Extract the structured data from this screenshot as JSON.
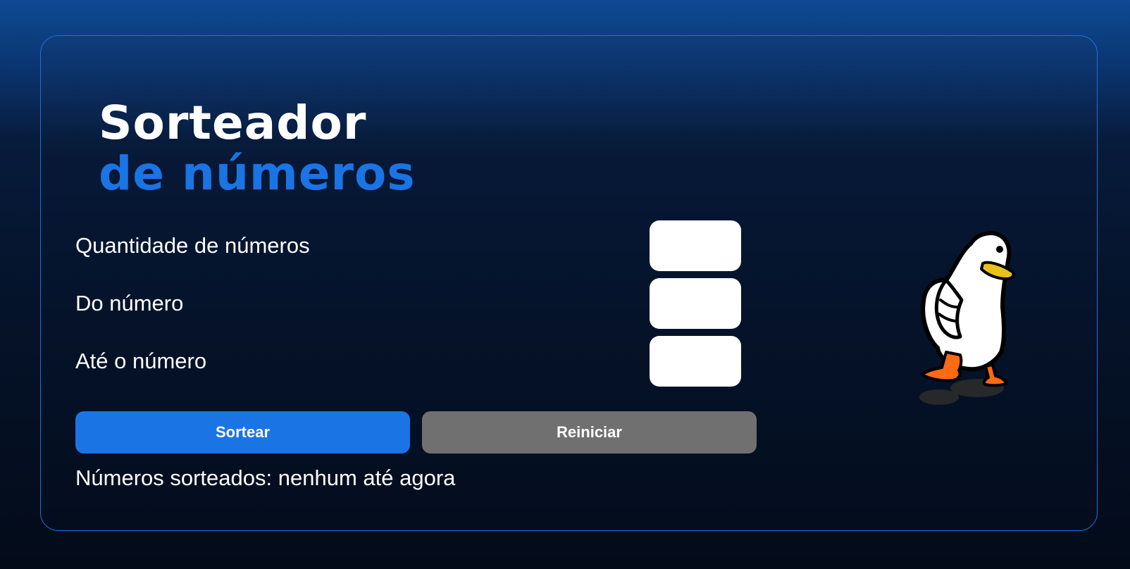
{
  "header": {
    "title_line1": "Sorteador",
    "title_line2": "de números"
  },
  "form": {
    "fields": [
      {
        "label": "Quantidade de números",
        "value": ""
      },
      {
        "label": "Do número",
        "value": ""
      },
      {
        "label": "Até o número",
        "value": ""
      }
    ]
  },
  "actions": {
    "draw_label": "Sortear",
    "reset_label": "Reiniciar"
  },
  "result": {
    "prefix": "Números sorteados:",
    "value": "nenhum até agora"
  },
  "illustration": {
    "icon": "duck-illustration"
  },
  "colors": {
    "accent": "#1b74e4",
    "secondary_button": "#707070",
    "card_border": "#1f6fe0"
  }
}
